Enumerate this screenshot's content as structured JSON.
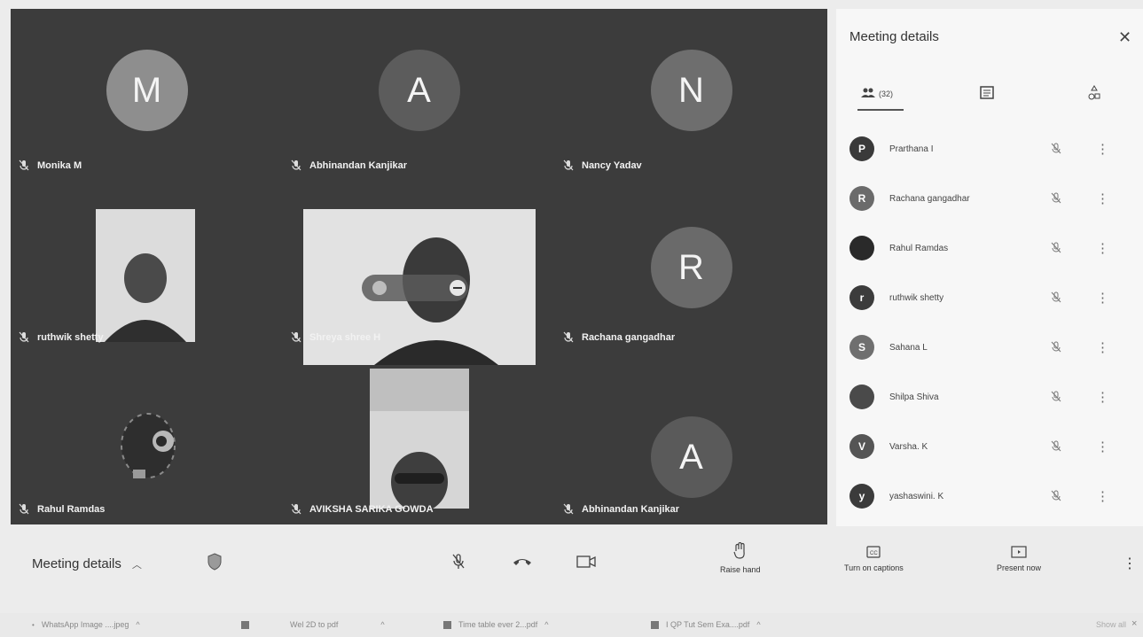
{
  "grid": {
    "tiles": [
      {
        "name": "Monika M",
        "initial": "M",
        "avatar_color": "#8e8e8e"
      },
      {
        "name": "Abhinandan Kanjikar",
        "initial": "A",
        "avatar_color": "#5c5c5c"
      },
      {
        "name": "Nancy Yadav",
        "initial": "N",
        "avatar_color": "#6e6e6e"
      },
      {
        "name": "ruthwik shetty",
        "initial": "",
        "avatar_color": ""
      },
      {
        "name": "Shreya shree H",
        "initial": "",
        "avatar_color": ""
      },
      {
        "name": "Rachana gangadhar",
        "initial": "R",
        "avatar_color": "#6a6a6a"
      },
      {
        "name": "Rahul Ramdas",
        "initial": "",
        "avatar_color": ""
      },
      {
        "name": "AVIKSHA SARIKA GOWDA",
        "initial": "",
        "avatar_color": ""
      },
      {
        "name": "Abhinandan Kanjikar",
        "initial": "A",
        "avatar_color": "#5a5a5a"
      }
    ]
  },
  "panel": {
    "title": "Meeting details",
    "close_icon": "close-icon",
    "people_count": "(32)",
    "participants": [
      {
        "initial": "P",
        "name": "Prarthana I",
        "color": "#3a3a3a"
      },
      {
        "initial": "R",
        "name": "Rachana gangadhar",
        "color": "#6b6b6b"
      },
      {
        "initial": "",
        "name": "Rahul Ramdas",
        "color": "#2a2a2a"
      },
      {
        "initial": "r",
        "name": "ruthwik shetty",
        "color": "#3c3c3c"
      },
      {
        "initial": "S",
        "name": "Sahana L",
        "color": "#6f6f6f"
      },
      {
        "initial": "",
        "name": "Shilpa Shiva",
        "color": "#4a4a4a"
      },
      {
        "initial": "V",
        "name": "Varsha. K",
        "color": "#555555"
      },
      {
        "initial": "y",
        "name": "yashaswini. K",
        "color": "#3b3b3b"
      }
    ]
  },
  "toolbar": {
    "details_label": "Meeting details",
    "raise_hand": "Raise hand",
    "captions": "Turn on captions",
    "present": "Present now"
  },
  "downloads": {
    "items": [
      "WhatsApp Image ....jpeg",
      "Wel 2D to pdf",
      "Time table ever 2...pdf",
      "I QP Tut Sem Exa....pdf"
    ],
    "show_all": "Show all"
  }
}
